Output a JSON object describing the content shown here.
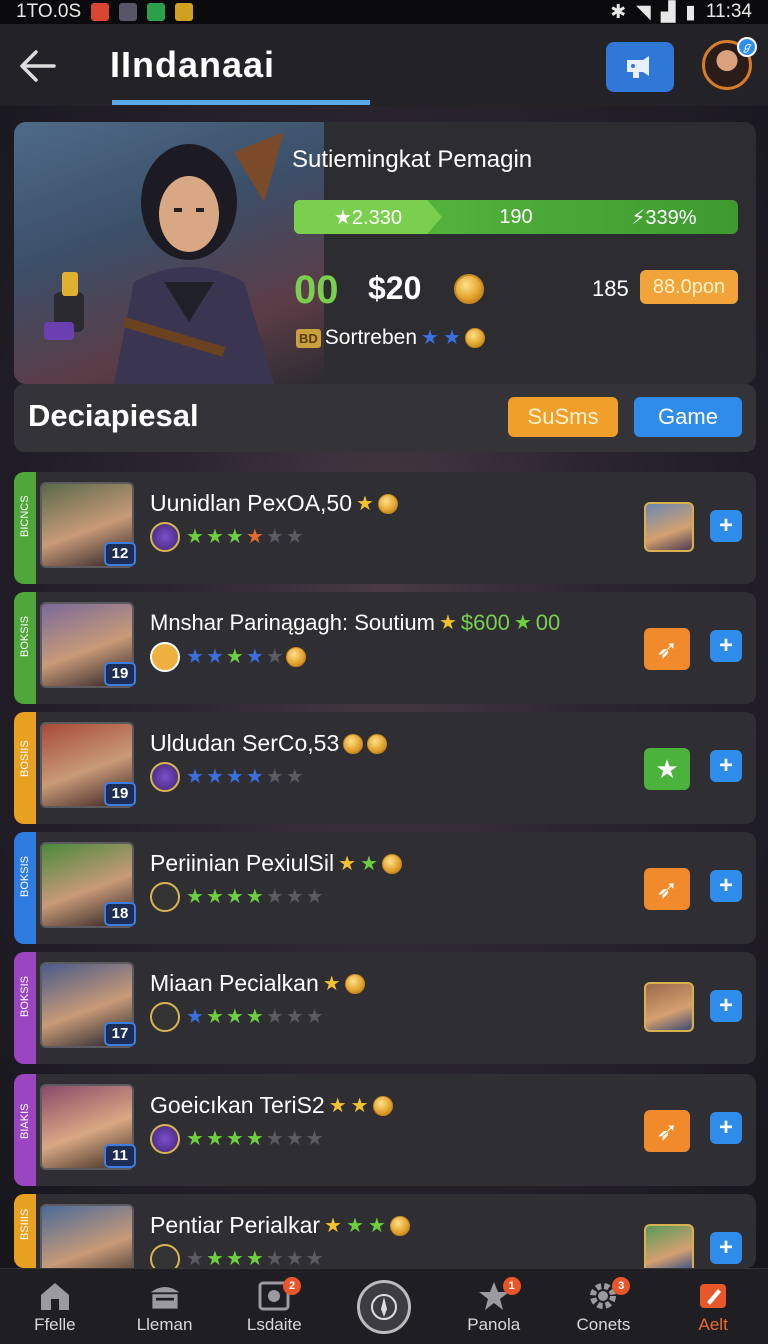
{
  "status": {
    "left_text": "1TO.0S",
    "time": "11:34"
  },
  "header": {
    "title": "IIndanaai"
  },
  "hero": {
    "name": "Sutiemingkat Pemagin",
    "progress": [
      "★2.330",
      "190",
      "⚡339%"
    ],
    "score_big": "00",
    "money": "$20",
    "count": "185",
    "pill": "88.0pon",
    "rank_tag": "BD",
    "rank_text": "Sortreben"
  },
  "section": {
    "title": "Deciapiesal",
    "btn_orange": "SuSms",
    "btn_blue": "Game"
  },
  "cards": [
    {
      "side": "BICNCS",
      "name": "Uunidlan PexOA,50",
      "level": "12",
      "stripe": "#4fa63a"
    },
    {
      "side": "BOKSIS",
      "name": "Mnshar Parinągagh: Soutium",
      "extra": "$600",
      "extra2": "00",
      "level": "19",
      "stripe": "#4fa63a"
    },
    {
      "side": "BOSIIS",
      "name": "Uldudan SerCo,53",
      "level": "19",
      "stripe": "#e8a020"
    },
    {
      "side": "BOKSIS",
      "name": "Periinian PexiulSil",
      "level": "18",
      "stripe": "#2f7ce0"
    },
    {
      "side": "BOKSIS",
      "name": "Miaan Pecialkan",
      "level": "17",
      "stripe": "#9b45c0"
    },
    {
      "side": "BIAKIS",
      "name": "Goeicıkan TeriS2",
      "level": "11",
      "stripe": "#9b45c0"
    },
    {
      "side": "BSIIIS",
      "name": "Pentiar Perialkar",
      "level": "",
      "stripe": "#e8a020"
    }
  ],
  "nav": [
    {
      "label": "Ffelle",
      "badge": ""
    },
    {
      "label": "Lleman",
      "badge": ""
    },
    {
      "label": "Lsdaite",
      "badge": "2"
    },
    {
      "label": "",
      "badge": ""
    },
    {
      "label": "Panola",
      "badge": "1"
    },
    {
      "label": "Conets",
      "badge": "3"
    },
    {
      "label": "Aelt",
      "badge": ""
    }
  ],
  "colors": {
    "accent": "#2f8cea",
    "orange": "#f0a02a",
    "green": "#6ccf3e"
  }
}
